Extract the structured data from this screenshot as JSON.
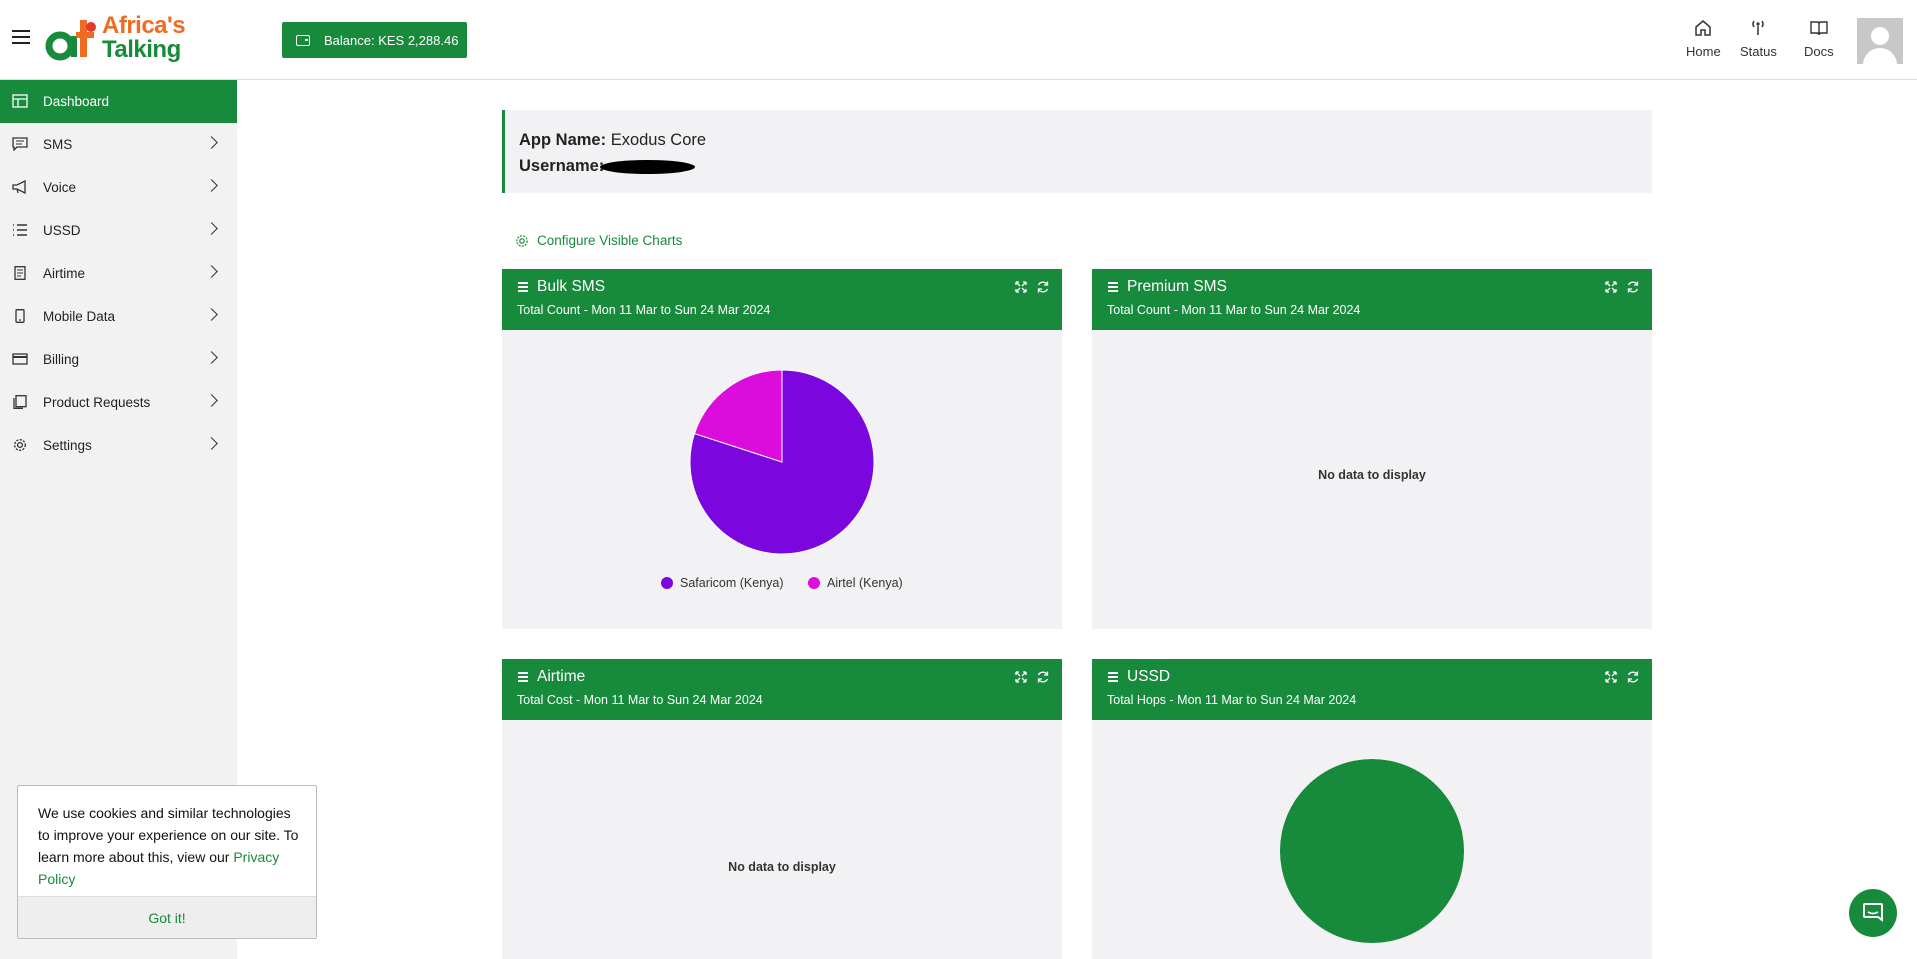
{
  "header": {
    "logo_line1": "Africa's",
    "logo_line2": "Talking",
    "balance_label": "Balance: KES 2,288.46",
    "nav": [
      {
        "label": "Home",
        "icon": "home-icon"
      },
      {
        "label": "Status",
        "icon": "antenna-icon"
      },
      {
        "label": "Docs",
        "icon": "book-icon"
      }
    ]
  },
  "sidebar": {
    "items": [
      {
        "label": "Dashboard",
        "icon": "dashboard-icon",
        "active": true
      },
      {
        "label": "SMS",
        "icon": "message-icon"
      },
      {
        "label": "Voice",
        "icon": "megaphone-icon"
      },
      {
        "label": "USSD",
        "icon": "list-icon"
      },
      {
        "label": "Airtime",
        "icon": "receipt-icon"
      },
      {
        "label": "Mobile Data",
        "icon": "phone-icon"
      },
      {
        "label": "Billing",
        "icon": "credit-card-icon"
      },
      {
        "label": "Product Requests",
        "icon": "documents-icon"
      },
      {
        "label": "Settings",
        "icon": "gear-icon"
      }
    ]
  },
  "app_info": {
    "app_name_label": "App Name:",
    "app_name_value": "Exodus Core",
    "username_label": "Username:"
  },
  "configure_label": "Configure Visible Charts",
  "panels": [
    {
      "title": "Bulk SMS",
      "subtitle": "Total Count - Mon 11 Mar to Sun 24 Mar 2024"
    },
    {
      "title": "Premium SMS",
      "subtitle": "Total Count - Mon 11 Mar to Sun 24 Mar 2024",
      "empty_text": "No data to display"
    },
    {
      "title": "Airtime",
      "subtitle": "Total Cost - Mon 11 Mar to Sun 24 Mar 2024",
      "empty_text": "No data to display"
    },
    {
      "title": "USSD",
      "subtitle": "Total Hops - Mon 11 Mar to Sun 24 Mar 2024"
    }
  ],
  "chart_data": [
    {
      "type": "pie",
      "categories": [
        "Safaricom (Kenya)",
        "Airtel (Kenya)"
      ],
      "values": [
        80,
        20
      ],
      "colors": [
        "#7b06de",
        "#dc0ddc"
      ],
      "legend": "bottom"
    },
    {
      "type": "pie",
      "categories": [
        ""
      ],
      "values": [
        100
      ],
      "colors": [
        "#178a3c"
      ]
    }
  ],
  "cookie": {
    "text": "We use cookies and similar technologies to improve your experience on our site. To learn more about this, view our",
    "link": "Privacy Policy",
    "button": "Got it!"
  },
  "colors": {
    "brand_green": "#178a3c",
    "brand_orange": "#f06b22",
    "sidebar_bg": "#f2f2f2",
    "panel_bg": "#f2f2f4"
  }
}
